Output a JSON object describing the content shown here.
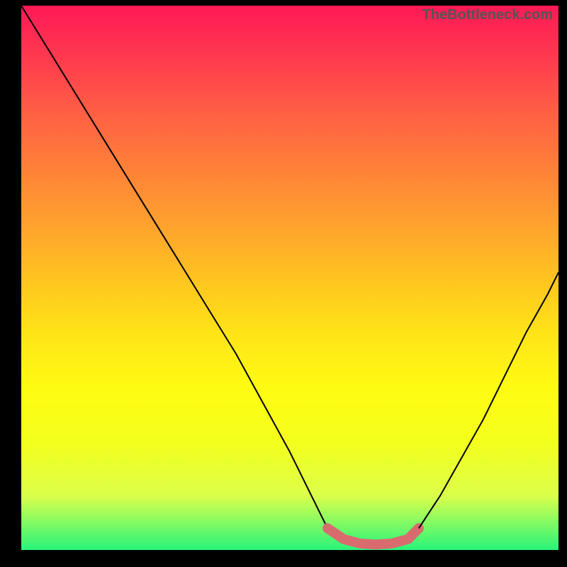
{
  "watermark": "TheBottleneck.com",
  "chart_data": {
    "type": "line",
    "title": "",
    "xlabel": "",
    "ylabel": "",
    "xlim": [
      0,
      100
    ],
    "ylim": [
      0,
      100
    ],
    "note": "Bottleneck curve over rainbow gradient. Two descending/ascending black curves meeting at a flat pink-highlighted trough. Values are estimated from pixels (no axis ticks visible).",
    "series": [
      {
        "name": "left-curve",
        "color": "#000000",
        "x": [
          0,
          5,
          10,
          15,
          20,
          25,
          30,
          35,
          40,
          45,
          50,
          55,
          57
        ],
        "y": [
          100,
          92,
          84,
          76,
          68,
          60,
          52,
          44,
          36,
          27,
          18,
          8,
          4
        ]
      },
      {
        "name": "trough-highlight",
        "color": "#d96b6f",
        "x": [
          57,
          60,
          63,
          66,
          69,
          72,
          74
        ],
        "y": [
          4,
          2,
          1.2,
          1,
          1.2,
          2,
          4
        ]
      },
      {
        "name": "right-curve",
        "color": "#000000",
        "x": [
          74,
          78,
          82,
          86,
          90,
          94,
          98,
          100
        ],
        "y": [
          4,
          10,
          17,
          24,
          32,
          40,
          47,
          51
        ]
      }
    ]
  }
}
